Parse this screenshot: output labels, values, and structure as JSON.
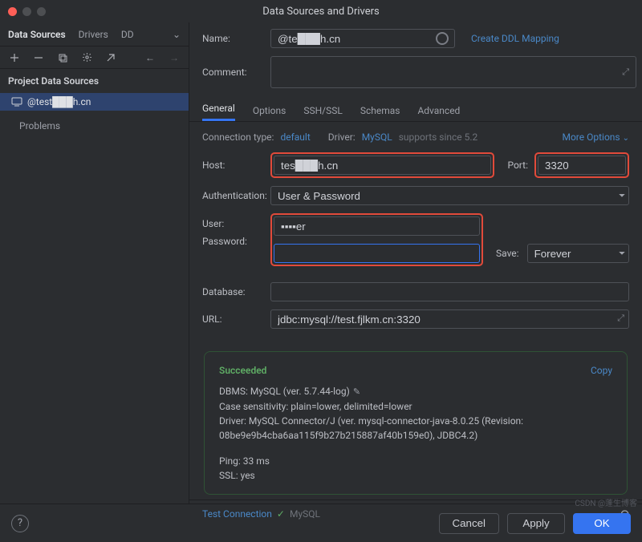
{
  "title": "Data Sources and Drivers",
  "left": {
    "tabs": [
      "Data Sources",
      "Drivers",
      "DD"
    ],
    "section": "Project Data Sources",
    "item": "@test███h.cn",
    "problems": "Problems"
  },
  "form": {
    "name_label": "Name:",
    "name_value": "@te███h.cn",
    "create_ddl": "Create DDL Mapping",
    "comment_label": "Comment:",
    "tabs": [
      "General",
      "Options",
      "SSH/SSL",
      "Schemas",
      "Advanced"
    ],
    "conn_type_label": "Connection type:",
    "conn_type_value": "default",
    "driver_label": "Driver:",
    "driver_value": "MySQL",
    "driver_support": "supports since 5.2",
    "more_options": "More Options",
    "host_label": "Host:",
    "host_value": "tes███h.cn",
    "port_label": "Port:",
    "port_value": "3320",
    "auth_label": "Authentication:",
    "auth_value": "User & Password",
    "user_label": "User:",
    "user_value": "▪▪▪▪er",
    "pass_label": "Password:",
    "pass_value": "",
    "save_label": "Save:",
    "save_value": "Forever",
    "db_label": "Database:",
    "db_value": "",
    "url_label": "URL:",
    "url_value": "jdbc:mysql://test.fjlkm.cn:3320"
  },
  "result": {
    "status": "Succeeded",
    "copy": "Copy",
    "dbms": "DBMS: MySQL (ver. 5.7.44-log)",
    "case": "Case sensitivity: plain=lower, delimited=lower",
    "driver": "Driver: MySQL Connector/J (ver. mysql-connector-java-8.0.25 (Revision: 08be9e9b4cba6aa115f9b27b215887af40b159e0), JDBC4.2)",
    "ping": "Ping: 33 ms",
    "ssl": "SSL: yes"
  },
  "footer": {
    "test": "Test Connection",
    "engine": "MySQL",
    "cancel": "Cancel",
    "apply": "Apply",
    "ok": "OK"
  },
  "watermark": "CSDN @蓬生博客"
}
